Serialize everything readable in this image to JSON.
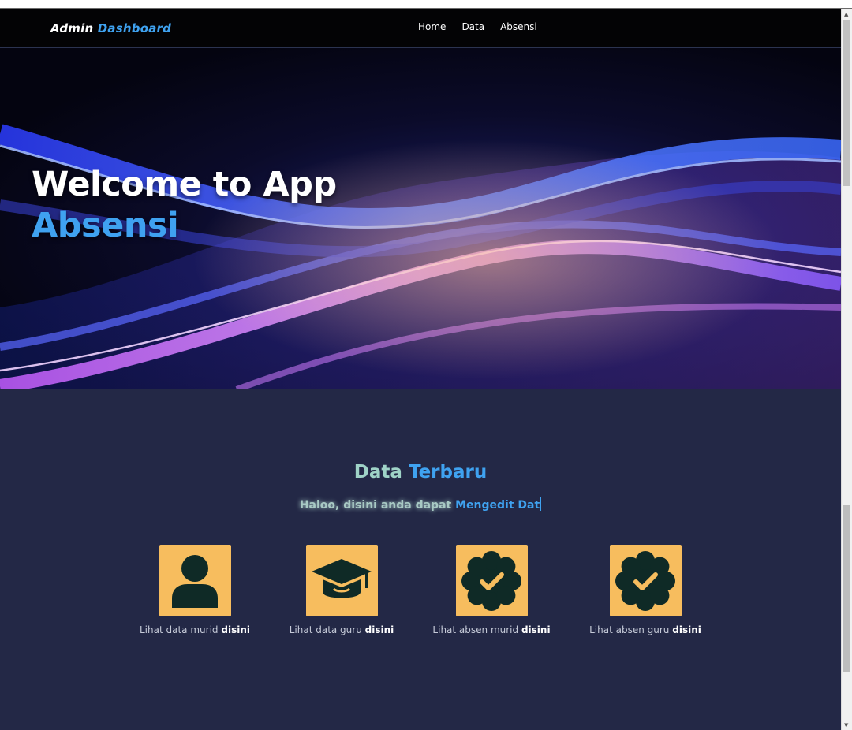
{
  "navbar": {
    "brand_main": "Admin",
    "brand_accent": "Dashboard",
    "links": [
      "Home",
      "Data",
      "Absensi"
    ]
  },
  "hero": {
    "title_line1": "Welcome to App",
    "title_line2": "Absensi"
  },
  "section": {
    "title_main": "Data",
    "title_accent": "Terbaru",
    "subtitle_main": "Haloo, disini anda dapat",
    "subtitle_accent": "Mengedit Dat"
  },
  "cards": [
    {
      "icon": "user-icon",
      "label": "Lihat data murid",
      "link": "disini"
    },
    {
      "icon": "graduation-cap-icon",
      "label": "Lihat data guru",
      "link": "disini"
    },
    {
      "icon": "verified-badge-icon",
      "label": "Lihat absen murid",
      "link": "disini"
    },
    {
      "icon": "verified-badge-icon",
      "label": "Lihat absen guru",
      "link": "disini"
    }
  ],
  "colors": {
    "accent": "#3fa2f0",
    "tile": "#f7bd5e",
    "section_bg": "#232846",
    "navbar_bg": "#030305",
    "icon": "#0f2a26"
  }
}
